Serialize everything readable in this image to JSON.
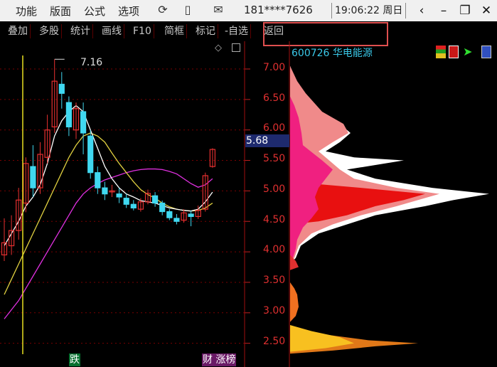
{
  "titlebar": {
    "menus": [
      "功能",
      "版面",
      "公式",
      "选项"
    ],
    "phone": "181****7626",
    "clock": "19:06:22 周日",
    "icons": [
      "refresh-icon",
      "phone-icon",
      "mail-icon"
    ],
    "window_buttons": [
      "back-icon",
      "minimize-icon",
      "restore-icon",
      "close-icon"
    ]
  },
  "toolbar": {
    "items": [
      "叠加",
      "多股",
      "统计",
      "画线",
      "F10",
      "简框",
      "标记",
      "-自选",
      "返回"
    ]
  },
  "stock": {
    "code_name": "600726 华电能源"
  },
  "price_axis": {
    "ticks": [
      "7.00",
      "6.50",
      "6.00",
      "5.50",
      "5.00",
      "4.50",
      "4.00",
      "3.50",
      "3.00",
      "2.50"
    ],
    "last_price": "5.68"
  },
  "chart": {
    "peak_label": "7.16",
    "signal_left": "跌",
    "signal_right": "财 涨榜"
  },
  "colors": {
    "up": "#e83030",
    "down": "#40d8f0",
    "ma1": "#ffffff",
    "ma2": "#e0d040",
    "ma3": "#e030e0",
    "highlight_box": "#e05050"
  },
  "chart_data": {
    "type": "candlestick",
    "ylim": [
      2.35,
      7.25
    ],
    "candles": [
      {
        "o": 3.95,
        "c": 4.15,
        "h": 4.55,
        "l": 3.85
      },
      {
        "o": 4.1,
        "c": 4.35,
        "h": 4.6,
        "l": 3.95
      },
      {
        "o": 4.35,
        "c": 4.85,
        "h": 5.05,
        "l": 4.2
      },
      {
        "o": 4.8,
        "c": 5.45,
        "h": 5.55,
        "l": 4.65
      },
      {
        "o": 5.4,
        "c": 5.05,
        "h": 5.75,
        "l": 4.9
      },
      {
        "o": 5.05,
        "c": 5.6,
        "h": 5.8,
        "l": 4.95
      },
      {
        "o": 5.55,
        "c": 6.0,
        "h": 6.25,
        "l": 5.45
      },
      {
        "o": 6.05,
        "c": 6.8,
        "h": 7.16,
        "l": 5.95
      },
      {
        "o": 6.75,
        "c": 6.6,
        "h": 6.95,
        "l": 6.35
      },
      {
        "o": 6.45,
        "c": 6.05,
        "h": 6.55,
        "l": 5.9
      },
      {
        "o": 6.0,
        "c": 6.35,
        "h": 6.45,
        "l": 5.85
      },
      {
        "o": 6.3,
        "c": 5.95,
        "h": 6.45,
        "l": 5.6
      },
      {
        "o": 5.9,
        "c": 5.3,
        "h": 6.0,
        "l": 5.2
      },
      {
        "o": 5.3,
        "c": 5.05,
        "h": 5.4,
        "l": 4.95
      },
      {
        "o": 5.05,
        "c": 4.95,
        "h": 5.15,
        "l": 4.85
      },
      {
        "o": 5.0,
        "c": 5.0,
        "h": 5.1,
        "l": 4.9
      },
      {
        "o": 4.95,
        "c": 4.9,
        "h": 5.05,
        "l": 4.8
      },
      {
        "o": 4.88,
        "c": 4.78,
        "h": 4.95,
        "l": 4.72
      },
      {
        "o": 4.78,
        "c": 4.72,
        "h": 4.85,
        "l": 4.68
      },
      {
        "o": 4.7,
        "c": 4.82,
        "h": 4.88,
        "l": 4.66
      },
      {
        "o": 4.82,
        "c": 4.96,
        "h": 5.02,
        "l": 4.78
      },
      {
        "o": 4.92,
        "c": 4.8,
        "h": 4.98,
        "l": 4.74
      },
      {
        "o": 4.8,
        "c": 4.66,
        "h": 4.84,
        "l": 4.6
      },
      {
        "o": 4.66,
        "c": 4.56,
        "h": 4.7,
        "l": 4.52
      },
      {
        "o": 4.55,
        "c": 4.5,
        "h": 4.62,
        "l": 4.45
      },
      {
        "o": 4.52,
        "c": 4.64,
        "h": 4.7,
        "l": 4.48
      },
      {
        "o": 4.62,
        "c": 4.58,
        "h": 4.68,
        "l": 4.42
      },
      {
        "o": 4.58,
        "c": 4.68,
        "h": 4.76,
        "l": 4.54
      },
      {
        "o": 4.7,
        "c": 5.25,
        "h": 5.3,
        "l": 4.66
      },
      {
        "o": 5.4,
        "c": 5.68,
        "h": 5.7,
        "l": 5.38
      }
    ],
    "ma1": [
      4.1,
      4.3,
      4.5,
      4.75,
      4.9,
      5.1,
      5.45,
      5.9,
      6.15,
      6.3,
      6.4,
      6.3,
      6.0,
      5.7,
      5.4,
      5.2,
      5.05,
      4.95,
      4.9,
      4.84,
      4.82,
      4.8,
      4.76,
      4.72,
      4.7,
      4.68,
      4.67,
      4.7,
      4.82,
      4.98
    ],
    "ma2": [
      3.3,
      3.55,
      3.8,
      4.05,
      4.3,
      4.55,
      4.8,
      5.05,
      5.3,
      5.55,
      5.75,
      5.9,
      5.95,
      5.9,
      5.8,
      5.62,
      5.45,
      5.3,
      5.15,
      5.02,
      4.94,
      4.88,
      4.8,
      4.74,
      4.7,
      4.68,
      4.67,
      4.68,
      4.72,
      4.8
    ],
    "ma3": [
      2.9,
      3.05,
      3.2,
      3.4,
      3.6,
      3.8,
      4.0,
      4.2,
      4.4,
      4.6,
      4.8,
      4.95,
      5.05,
      5.12,
      5.18,
      5.22,
      5.26,
      5.3,
      5.33,
      5.35,
      5.36,
      5.36,
      5.35,
      5.32,
      5.28,
      5.2,
      5.12,
      5.06,
      5.1,
      5.2
    ]
  }
}
